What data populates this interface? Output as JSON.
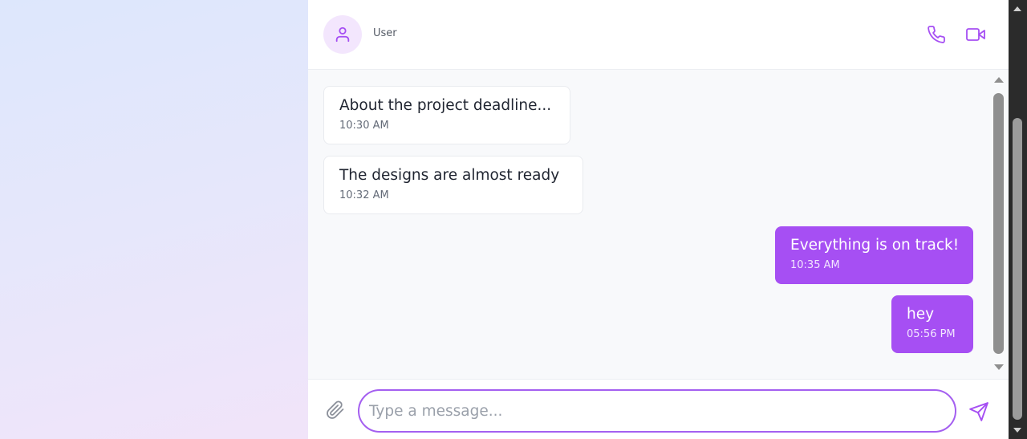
{
  "colors": {
    "accent": "#a64ff3",
    "incoming_bubble": "#ffffff",
    "chat_background": "#f8f9fb"
  },
  "header": {
    "contact_name": "User",
    "icons": {
      "avatar": "user-icon",
      "call": "phone-icon",
      "video": "video-camera-icon"
    }
  },
  "messages": [
    {
      "direction": "incoming",
      "text": "About the project deadline...",
      "time": "10:30 AM"
    },
    {
      "direction": "incoming",
      "text": "The designs are almost ready",
      "time": "10:32 AM"
    },
    {
      "direction": "outgoing",
      "text": "Everything is on track!",
      "time": "10:35 AM"
    },
    {
      "direction": "outgoing",
      "text": "hey",
      "time": "05:56 PM"
    }
  ],
  "composer": {
    "placeholder": "Type a message...",
    "value": "",
    "icons": {
      "attach": "paperclip-icon",
      "send": "send-icon"
    }
  }
}
